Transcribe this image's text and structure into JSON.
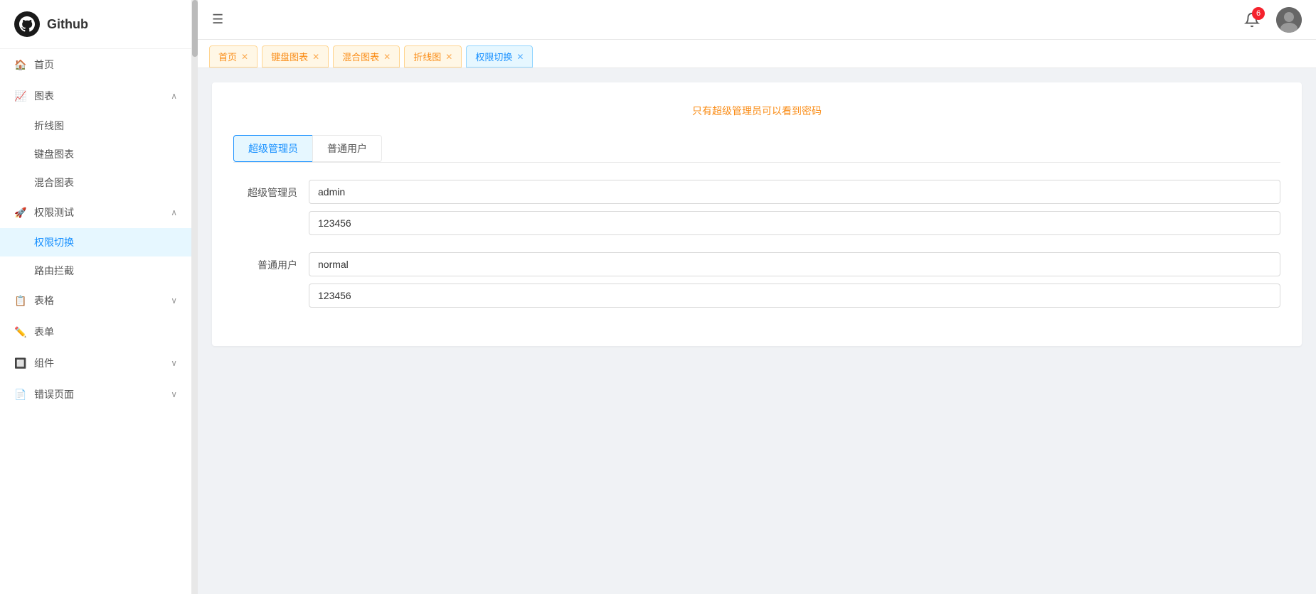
{
  "app": {
    "title": "Github",
    "logo_alt": "github-logo"
  },
  "header": {
    "hamburger_icon": "☰",
    "notification_count": "6",
    "avatar_emoji": "👤"
  },
  "tabs": [
    {
      "id": "tab-home",
      "label": "首页",
      "style": "default",
      "closable": true
    },
    {
      "id": "tab-keyboard",
      "label": "键盘图表",
      "style": "orange",
      "closable": true
    },
    {
      "id": "tab-mixed",
      "label": "混合图表",
      "style": "orange",
      "closable": true
    },
    {
      "id": "tab-line",
      "label": "折线图",
      "style": "orange",
      "closable": true
    },
    {
      "id": "tab-permission",
      "label": "权限切换",
      "style": "active",
      "closable": true
    }
  ],
  "sidebar": {
    "logo_title": "Github",
    "nav_items": [
      {
        "id": "home",
        "label": "首页",
        "icon": "🏠",
        "has_children": false
      },
      {
        "id": "charts",
        "label": "图表",
        "icon": "📈",
        "has_children": true,
        "expanded": true
      },
      {
        "id": "line-chart",
        "label": "折线图",
        "parent": "charts"
      },
      {
        "id": "keyboard-chart",
        "label": "键盘图表",
        "parent": "charts"
      },
      {
        "id": "mixed-chart",
        "label": "混合图表",
        "parent": "charts"
      },
      {
        "id": "permission-test",
        "label": "权限测试",
        "icon": "🚀",
        "has_children": true,
        "expanded": true
      },
      {
        "id": "permission-switch",
        "label": "权限切换",
        "parent": "permission-test",
        "active": true
      },
      {
        "id": "route-guard",
        "label": "路由拦截",
        "parent": "permission-test"
      },
      {
        "id": "table",
        "label": "表格",
        "icon": "📋",
        "has_children": true
      },
      {
        "id": "form",
        "label": "表单",
        "icon": "✏️",
        "has_children": false
      },
      {
        "id": "components",
        "label": "组件",
        "icon": "🔲",
        "has_children": true
      },
      {
        "id": "error-pages",
        "label": "错误页面",
        "icon": "📄",
        "has_children": true
      }
    ]
  },
  "page": {
    "notice": "只有超级管理员可以看到密码",
    "role_tabs": [
      {
        "id": "admin",
        "label": "超级管理员",
        "active": true
      },
      {
        "id": "normal",
        "label": "普通用户",
        "active": false
      }
    ],
    "admin_section": {
      "label": "超级管理员",
      "username": "admin",
      "password": "123456"
    },
    "normal_section": {
      "label": "普通用户",
      "username": "normal",
      "password": "123456"
    }
  }
}
